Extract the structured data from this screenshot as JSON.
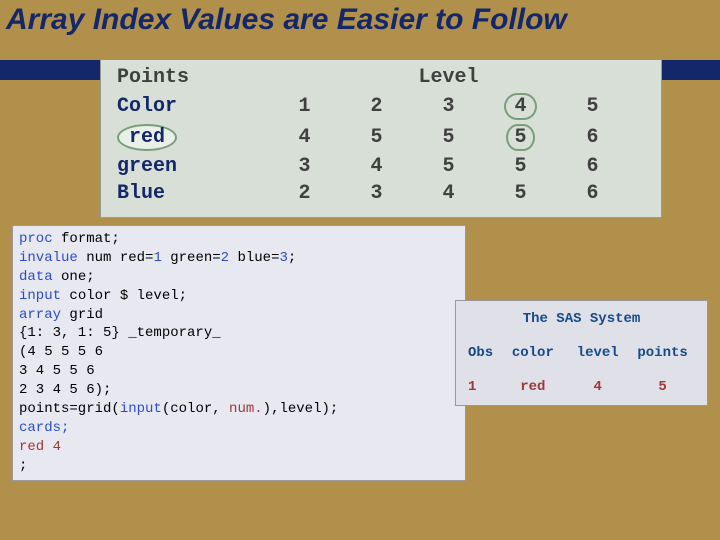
{
  "title": "Array Index Values are Easier to Follow",
  "table": {
    "hdr_points": "Points",
    "hdr_level": "Level",
    "levels": [
      "1",
      "2",
      "3",
      "4",
      "5"
    ],
    "rows": [
      {
        "label": "Color",
        "cells": [
          "1",
          "2",
          "3",
          "4",
          "5"
        ]
      },
      {
        "label": "red",
        "cells": [
          "4",
          "5",
          "5",
          "5",
          "6"
        ]
      },
      {
        "label": "green",
        "cells": [
          "3",
          "4",
          "5",
          "5",
          "6"
        ]
      },
      {
        "label": "Blue",
        "cells": [
          "2",
          "3",
          "4",
          "5",
          "6"
        ]
      }
    ]
  },
  "code": {
    "l1a": "proc",
    "l1b": " format",
    "l2a": "   invalue",
    "l2b": " num red=",
    "l2c": "1",
    "l2d": " green=",
    "l2e": "2",
    "l2f": " blue=",
    "l2g": "3",
    "l2h": ";",
    "l3a": "data",
    "l3b": " one;",
    "l4a": "input",
    "l4b": " color $ level;",
    "l5a": "array",
    "l5b": " grid",
    "l6": "        {1: 3, 1: 5} _temporary_",
    "l7": "        (4 5 5 5 6",
    "l8": "         3 4 5 5 6",
    "l9": "         2 3 4 5 6);",
    "l10a": "points=grid(",
    "l10b": "input",
    "l10c": "(color,",
    "l10d": " num.",
    "l10e": "),level);",
    "l11": "cards;",
    "l12": "red 4",
    "l13": ";"
  },
  "output": {
    "system": "The SAS System",
    "h_obs": "Obs",
    "h_color": "color",
    "h_level": "level",
    "h_points": "points",
    "v_obs": "1",
    "v_color": "red",
    "v_level": "4",
    "v_points": "5"
  }
}
